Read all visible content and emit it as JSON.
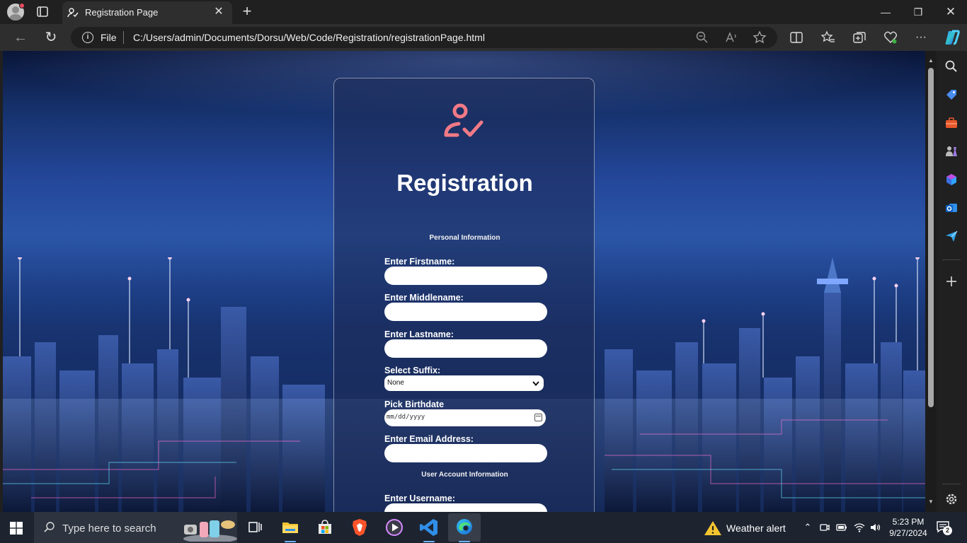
{
  "browser": {
    "tab_title": "Registration Page",
    "address_scheme_label": "File",
    "url": "C:/Users/admin/Documents/Dorsu/Web/Code/Registration/registrationPage.html"
  },
  "form": {
    "title": "Registration",
    "personal_section": "Personal Information",
    "account_section": "User Account Information",
    "firstname_label": "Enter Firstname:",
    "middlename_label": "Enter Middlename:",
    "lastname_label": "Enter Lastname:",
    "suffix_label": "Select Suffix:",
    "suffix_value": "None",
    "birthdate_label": "Pick Birthdate",
    "birthdate_placeholder": "mm/dd/yyyy",
    "email_label": "Enter Email Address:",
    "username_label": "Enter Username:"
  },
  "taskbar": {
    "search_placeholder": "Type here to search",
    "weather_text": "Weather alert",
    "time": "5:23 PM",
    "date": "9/27/2024",
    "notification_count": "2"
  },
  "colors": {
    "accent_pink": "#f07a86",
    "edge_blue": "#1e90ff",
    "vscode_blue": "#2f8fe8"
  }
}
